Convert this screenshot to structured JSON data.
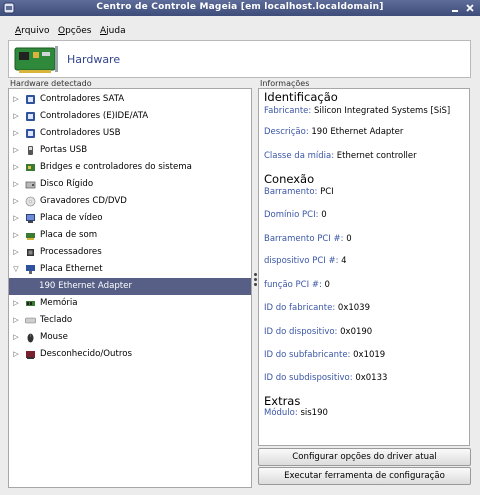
{
  "window": {
    "title": "Centro de Controle Mageia  [em localhost.localdomain]"
  },
  "menu": {
    "arquivo": "Arquivo",
    "opcoes": "Opções",
    "ajuda": "Ajuda"
  },
  "banner": {
    "label": "Hardware"
  },
  "labels": {
    "detected": "Hardware detectado",
    "info": "Informações"
  },
  "tree": {
    "items": [
      {
        "label": "Controladores SATA",
        "icon": "sata-controller-icon",
        "expanded": false
      },
      {
        "label": "Controladores (E)IDE/ATA",
        "icon": "ide-controller-icon",
        "expanded": false
      },
      {
        "label": "Controladores USB",
        "icon": "usb-controller-icon",
        "expanded": false
      },
      {
        "label": "Portas USB",
        "icon": "usb-port-icon",
        "expanded": false
      },
      {
        "label": "Bridges e controladores do sistema",
        "icon": "bridge-icon",
        "expanded": false
      },
      {
        "label": "Disco Rígido",
        "icon": "hard-disk-icon",
        "expanded": false
      },
      {
        "label": "Gravadores CD/DVD",
        "icon": "cd-dvd-icon",
        "expanded": false
      },
      {
        "label": "Placa de vídeo",
        "icon": "video-card-icon",
        "expanded": false
      },
      {
        "label": "Placa de som",
        "icon": "sound-card-icon",
        "expanded": false
      },
      {
        "label": "Processadores",
        "icon": "processor-icon",
        "expanded": false
      },
      {
        "label": "Placa Ethernet",
        "icon": "ethernet-card-icon",
        "expanded": true
      },
      {
        "label": "190 Ethernet Adapter",
        "child": true,
        "selected": true
      },
      {
        "label": "Memória",
        "icon": "memory-icon",
        "expanded": false
      },
      {
        "label": "Teclado",
        "icon": "keyboard-icon",
        "expanded": false
      },
      {
        "label": "Mouse",
        "icon": "mouse-icon",
        "expanded": false
      },
      {
        "label": "Desconhecido/Outros",
        "icon": "unknown-device-icon",
        "expanded": false
      }
    ]
  },
  "info": {
    "identification": "Identificação",
    "fabricante_k": "Fabricante:",
    "fabricante_v": "Silicon Integrated Systems [SiS]",
    "descricao_k": "Descrição:",
    "descricao_v": "190 Ethernet Adapter",
    "classe_k": "Classe da mídia:",
    "classe_v": "Ethernet controller",
    "connection": "Conexão",
    "barramento_k": "Barramento:",
    "barramento_v": "PCI",
    "dominio_k": "Domínio PCI:",
    "dominio_v": "0",
    "barramento_pci_k": "Barramento PCI #:",
    "barramento_pci_v": "0",
    "dispositivo_k": "dispositivo PCI #:",
    "dispositivo_v": "4",
    "funcao_k": "função PCI #:",
    "funcao_v": "0",
    "id_fabricante_k": "ID do fabricante:",
    "id_fabricante_v": "0x1039",
    "id_dispositivo_k": "ID do dispositivo:",
    "id_dispositivo_v": "0x0190",
    "id_subfabricante_k": "ID do subfabricante:",
    "id_subfabricante_v": "0x1019",
    "id_subdispositivo_k": "ID do subdispositivo:",
    "id_subdispositivo_v": "0x0133",
    "extras": "Extras",
    "modulo_k": "Módulo:",
    "modulo_v": "sis190"
  },
  "buttons": {
    "configure_driver": "Configurar opções do driver atual",
    "run_config_tool": "Executar ferramenta de configuração"
  }
}
